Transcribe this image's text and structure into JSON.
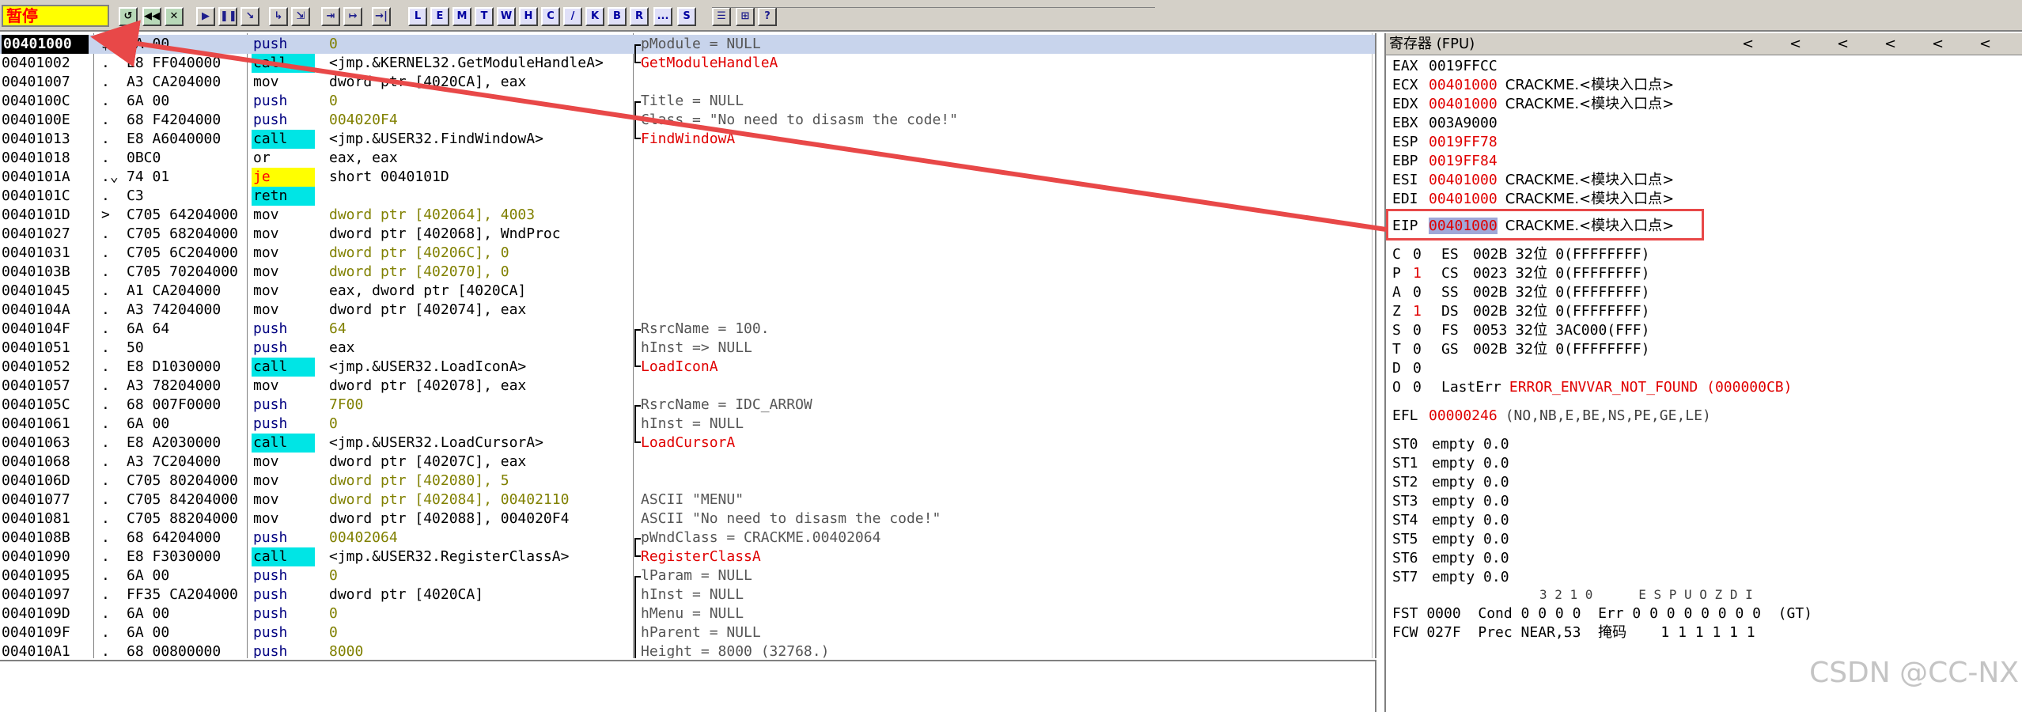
{
  "toolbar": {
    "state": "暂停",
    "buttons": [
      "↺",
      "◀◀",
      "✕",
      "▶",
      "❚❚",
      "↘",
      "↳",
      "⇲",
      "⇥",
      "↦",
      "→|",
      "L",
      "E",
      "M",
      "T",
      "W",
      "H",
      "C",
      "/",
      "K",
      "B",
      "R",
      "...",
      "S",
      "☰",
      "⊞",
      "?"
    ]
  },
  "disasm": {
    "rows": [
      {
        "addr": "00401000",
        "mark": "$",
        "hex": "6A 00",
        "mnemonic": "push",
        "mtype": "push",
        "operand": "0",
        "comment": "pModule = NULL",
        "ctype": "normal",
        "bracket": "start",
        "current": true
      },
      {
        "addr": "00401002",
        "mark": ".",
        "hex": "E8 FF040000",
        "mnemonic": "call",
        "mtype": "call",
        "operand": "<jmp.&KERNEL32.GetModuleHandleA>",
        "comment": "GetModuleHandleA",
        "ctype": "red",
        "bracket": "end"
      },
      {
        "addr": "00401007",
        "mark": ".",
        "hex": "A3 CA204000",
        "mnemonic": "mov",
        "mtype": "mov",
        "operand": "dword ptr [4020CA], eax",
        "comment": "",
        "ctype": "normal",
        "bracket": ""
      },
      {
        "addr": "0040100C",
        "mark": ".",
        "hex": "6A 00",
        "mnemonic": "push",
        "mtype": "push",
        "operand": "0",
        "comment": "Title = NULL",
        "ctype": "normal",
        "bracket": "start"
      },
      {
        "addr": "0040100E",
        "mark": ".",
        "hex": "68 F4204000",
        "mnemonic": "push",
        "mtype": "push",
        "operand": "004020F4",
        "comment": "Class = \"No need to disasm the code!\"",
        "ctype": "normal",
        "bracket": "mid"
      },
      {
        "addr": "00401013",
        "mark": ".",
        "hex": "E8 A6040000",
        "mnemonic": "call",
        "mtype": "call",
        "operand": "<jmp.&USER32.FindWindowA>",
        "comment": "FindWindowA",
        "ctype": "red",
        "bracket": "end"
      },
      {
        "addr": "00401018",
        "mark": ".",
        "hex": "0BC0",
        "mnemonic": "or",
        "mtype": "or",
        "operand": "eax, eax",
        "comment": "",
        "ctype": "normal",
        "bracket": ""
      },
      {
        "addr": "0040101A",
        "mark": ".⌄",
        "hex": "74 01",
        "mnemonic": "je",
        "mtype": "je",
        "operand": "short 0040101D",
        "comment": "",
        "ctype": "normal",
        "bracket": ""
      },
      {
        "addr": "0040101C",
        "mark": ".",
        "hex": "C3",
        "mnemonic": "retn",
        "mtype": "retn",
        "operand": "",
        "comment": "",
        "ctype": "normal",
        "bracket": ""
      },
      {
        "addr": "0040101D",
        "mark": ">",
        "hex": "C705 64204000",
        "mnemonic": "mov",
        "mtype": "mov",
        "operand": "dword ptr [402064], 4003",
        "comment": "",
        "ctype": "normal",
        "bracket": ""
      },
      {
        "addr": "00401027",
        "mark": ".",
        "hex": "C705 68204000",
        "mnemonic": "mov",
        "mtype": "mov",
        "operand": "dword ptr [402068], WndProc",
        "comment": "",
        "ctype": "normal",
        "bracket": ""
      },
      {
        "addr": "00401031",
        "mark": ".",
        "hex": "C705 6C204000",
        "mnemonic": "mov",
        "mtype": "mov",
        "operand": "dword ptr [40206C], 0",
        "comment": "",
        "ctype": "normal",
        "bracket": ""
      },
      {
        "addr": "0040103B",
        "mark": ".",
        "hex": "C705 70204000",
        "mnemonic": "mov",
        "mtype": "mov",
        "operand": "dword ptr [402070], 0",
        "comment": "",
        "ctype": "normal",
        "bracket": ""
      },
      {
        "addr": "00401045",
        "mark": ".",
        "hex": "A1 CA204000",
        "mnemonic": "mov",
        "mtype": "mov",
        "operand": "eax, dword ptr [4020CA]",
        "comment": "",
        "ctype": "normal",
        "bracket": ""
      },
      {
        "addr": "0040104A",
        "mark": ".",
        "hex": "A3 74204000",
        "mnemonic": "mov",
        "mtype": "mov",
        "operand": "dword ptr [402074], eax",
        "comment": "",
        "ctype": "normal",
        "bracket": ""
      },
      {
        "addr": "0040104F",
        "mark": ".",
        "hex": "6A 64",
        "mnemonic": "push",
        "mtype": "push",
        "operand": "64",
        "comment": "RsrcName = 100.",
        "ctype": "normal",
        "bracket": "start"
      },
      {
        "addr": "00401051",
        "mark": ".",
        "hex": "50",
        "mnemonic": "push",
        "mtype": "push",
        "operand": "eax",
        "comment": "hInst => NULL",
        "ctype": "normal",
        "bracket": "mid"
      },
      {
        "addr": "00401052",
        "mark": ".",
        "hex": "E8 D1030000",
        "mnemonic": "call",
        "mtype": "call",
        "operand": "<jmp.&USER32.LoadIconA>",
        "comment": "LoadIconA",
        "ctype": "red",
        "bracket": "end"
      },
      {
        "addr": "00401057",
        "mark": ".",
        "hex": "A3 78204000",
        "mnemonic": "mov",
        "mtype": "mov",
        "operand": "dword ptr [402078], eax",
        "comment": "",
        "ctype": "normal",
        "bracket": ""
      },
      {
        "addr": "0040105C",
        "mark": ".",
        "hex": "68 007F0000",
        "mnemonic": "push",
        "mtype": "push",
        "operand": "7F00",
        "comment": "RsrcName = IDC_ARROW",
        "ctype": "normal",
        "bracket": "start"
      },
      {
        "addr": "00401061",
        "mark": ".",
        "hex": "6A 00",
        "mnemonic": "push",
        "mtype": "push",
        "operand": "0",
        "comment": "hInst = NULL",
        "ctype": "normal",
        "bracket": "mid"
      },
      {
        "addr": "00401063",
        "mark": ".",
        "hex": "E8 A2030000",
        "mnemonic": "call",
        "mtype": "call",
        "operand": "<jmp.&USER32.LoadCursorA>",
        "comment": "LoadCursorA",
        "ctype": "red",
        "bracket": "end"
      },
      {
        "addr": "00401068",
        "mark": ".",
        "hex": "A3 7C204000",
        "mnemonic": "mov",
        "mtype": "mov",
        "operand": "dword ptr [40207C], eax",
        "comment": "",
        "ctype": "normal",
        "bracket": ""
      },
      {
        "addr": "0040106D",
        "mark": ".",
        "hex": "C705 80204000",
        "mnemonic": "mov",
        "mtype": "mov",
        "operand": "dword ptr [402080], 5",
        "comment": "",
        "ctype": "normal",
        "bracket": ""
      },
      {
        "addr": "00401077",
        "mark": ".",
        "hex": "C705 84204000",
        "mnemonic": "mov",
        "mtype": "mov",
        "operand": "dword ptr [402084], 00402110",
        "comment": "ASCII \"MENU\"",
        "ctype": "normal",
        "bracket": ""
      },
      {
        "addr": "00401081",
        "mark": ".",
        "hex": "C705 88204000",
        "mnemonic": "mov",
        "mtype": "mov",
        "operand": "dword ptr [402088], 004020F4",
        "comment": "ASCII \"No need to disasm the code!\"",
        "ctype": "normal",
        "bracket": ""
      },
      {
        "addr": "0040108B",
        "mark": ".",
        "hex": "68 64204000",
        "mnemonic": "push",
        "mtype": "push",
        "operand": "00402064",
        "comment": "pWndClass = CRACKME.00402064",
        "ctype": "normal",
        "bracket": "start"
      },
      {
        "addr": "00401090",
        "mark": ".",
        "hex": "E8 F3030000",
        "mnemonic": "call",
        "mtype": "call",
        "operand": "<jmp.&USER32.RegisterClassA>",
        "comment": "RegisterClassA",
        "ctype": "red",
        "bracket": "end"
      },
      {
        "addr": "00401095",
        "mark": ".",
        "hex": "6A 00",
        "mnemonic": "push",
        "mtype": "push",
        "operand": "0",
        "comment": "lParam = NULL",
        "ctype": "normal",
        "bracket": "start"
      },
      {
        "addr": "00401097",
        "mark": ".",
        "hex": "FF35 CA204000",
        "mnemonic": "push",
        "mtype": "push",
        "operand": "dword ptr [4020CA]",
        "comment": "hInst = NULL",
        "ctype": "normal",
        "bracket": "mid"
      },
      {
        "addr": "0040109D",
        "mark": ".",
        "hex": "6A 00",
        "mnemonic": "push",
        "mtype": "push",
        "operand": "0",
        "comment": "hMenu = NULL",
        "ctype": "normal",
        "bracket": "mid"
      },
      {
        "addr": "0040109F",
        "mark": ".",
        "hex": "6A 00",
        "mnemonic": "push",
        "mtype": "push",
        "operand": "0",
        "comment": "hParent = NULL",
        "ctype": "normal",
        "bracket": "mid"
      },
      {
        "addr": "004010A1",
        "mark": ".",
        "hex": "68 00800000",
        "mnemonic": "push",
        "mtype": "push",
        "operand": "8000",
        "comment": "Height = 8000 (32768.)",
        "ctype": "normal",
        "bracket": "mid"
      }
    ]
  },
  "registers": {
    "title": "寄存器 (FPU)",
    "arrows": [
      "<",
      "<",
      "<",
      "<",
      "<",
      "<"
    ],
    "gp": [
      {
        "name": "EAX",
        "value": "0019FFCC",
        "red": false,
        "note": ""
      },
      {
        "name": "ECX",
        "value": "00401000",
        "red": true,
        "note": "CRACKME.<模块入口点>"
      },
      {
        "name": "EDX",
        "value": "00401000",
        "red": true,
        "note": "CRACKME.<模块入口点>"
      },
      {
        "name": "EBX",
        "value": "003A9000",
        "red": false,
        "note": ""
      },
      {
        "name": "ESP",
        "value": "0019FF78",
        "red": true,
        "note": ""
      },
      {
        "name": "EBP",
        "value": "0019FF84",
        "red": true,
        "note": ""
      },
      {
        "name": "ESI",
        "value": "00401000",
        "red": true,
        "note": "CRACKME.<模块入口点>"
      },
      {
        "name": "EDI",
        "value": "00401000",
        "red": true,
        "note": "CRACKME.<模块入口点>"
      }
    ],
    "eip": {
      "name": "EIP",
      "value": "00401000",
      "note": "CRACKME.<模块入口点>"
    },
    "flags": [
      {
        "f": "C",
        "v": "0",
        "red": false,
        "seg": "ES",
        "sv": "002B",
        "bits": "32位",
        "desc": "0(FFFFFFFF)"
      },
      {
        "f": "P",
        "v": "1",
        "red": true,
        "seg": "CS",
        "sv": "0023",
        "bits": "32位",
        "desc": "0(FFFFFFFF)"
      },
      {
        "f": "A",
        "v": "0",
        "red": false,
        "seg": "SS",
        "sv": "002B",
        "bits": "32位",
        "desc": "0(FFFFFFFF)"
      },
      {
        "f": "Z",
        "v": "1",
        "red": true,
        "seg": "DS",
        "sv": "002B",
        "bits": "32位",
        "desc": "0(FFFFFFFF)"
      },
      {
        "f": "S",
        "v": "0",
        "red": false,
        "seg": "FS",
        "sv": "0053",
        "bits": "32位",
        "desc": "3AC000(FFF)"
      },
      {
        "f": "T",
        "v": "0",
        "red": false,
        "seg": "GS",
        "sv": "002B",
        "bits": "32位",
        "desc": "0(FFFFFFFF)"
      },
      {
        "f": "D",
        "v": "0",
        "red": false,
        "seg": "",
        "sv": "",
        "bits": "",
        "desc": ""
      },
      {
        "f": "O",
        "v": "0",
        "red": false,
        "seg": "LastErr",
        "sv": "",
        "bits": "",
        "desc": "ERROR_ENVVAR_NOT_FOUND (000000CB)"
      }
    ],
    "efl": {
      "name": "EFL",
      "value": "00000246",
      "desc": "(NO,NB,E,BE,NS,PE,GE,LE)"
    },
    "st": [
      {
        "name": "ST0",
        "value": "empty 0.0"
      },
      {
        "name": "ST1",
        "value": "empty 0.0"
      },
      {
        "name": "ST2",
        "value": "empty 0.0"
      },
      {
        "name": "ST3",
        "value": "empty 0.0"
      },
      {
        "name": "ST4",
        "value": "empty 0.0"
      },
      {
        "name": "ST5",
        "value": "empty 0.0"
      },
      {
        "name": "ST6",
        "value": "empty 0.0"
      },
      {
        "name": "ST7",
        "value": "empty 0.0"
      }
    ],
    "fpu_header": "3 2 1 0      E S P U O Z D I",
    "fst": "FST 0000  Cond 0 0 0 0  Err 0 0 0 0 0 0 0 0  (GT)",
    "fcw": "FCW 027F  Prec NEAR,53  掩码    1 1 1 1 1 1"
  },
  "watermark": "CSDN @CC-NX",
  "colors": {
    "call": "#00e5e5",
    "je": "#ffff00",
    "red": "#e00000",
    "annotation": "#e84848"
  }
}
